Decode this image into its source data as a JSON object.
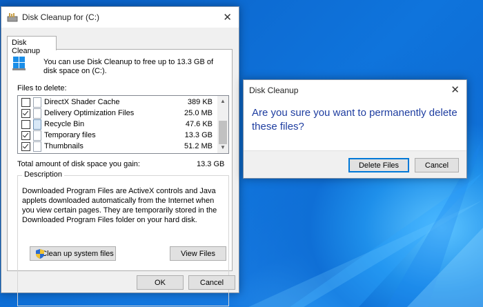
{
  "main_window": {
    "title": "Disk Cleanup for  (C:)",
    "tab_label": "Disk Cleanup",
    "intro_text": "You can use Disk Cleanup to free up to 13.3 GB of disk space on  (C:).",
    "files_to_delete_label": "Files to delete:",
    "files": [
      {
        "name": "DirectX Shader Cache",
        "size": "389 KB",
        "checked": false,
        "icon": "file-icon"
      },
      {
        "name": "Delivery Optimization Files",
        "size": "25.0 MB",
        "checked": true,
        "icon": "file-icon"
      },
      {
        "name": "Recycle Bin",
        "size": "47.6 KB",
        "checked": false,
        "icon": "recycle-bin-icon"
      },
      {
        "name": "Temporary files",
        "size": "13.3 GB",
        "checked": true,
        "icon": "file-icon"
      },
      {
        "name": "Thumbnails",
        "size": "51.2 MB",
        "checked": true,
        "icon": "file-icon"
      }
    ],
    "total_label": "Total amount of disk space you gain:",
    "total_value": "13.3 GB",
    "description_title": "Description",
    "description_text": "Downloaded Program Files are ActiveX controls and Java applets downloaded automatically from the Internet when you view certain pages. They are temporarily stored in the Downloaded Program Files folder on your hard disk.",
    "cleanup_system_button": "Clean up system files",
    "view_files_button": "View Files",
    "ok_button": "OK",
    "cancel_button": "Cancel"
  },
  "confirm_dialog": {
    "title": "Disk Cleanup",
    "message": "Are you sure you want to permanently delete these files?",
    "delete_button": "Delete Files",
    "cancel_button": "Cancel"
  },
  "colors": {
    "dialog_message": "#1e3da0",
    "focus_border": "#0078d7",
    "desktop": "#0f6fd6"
  }
}
